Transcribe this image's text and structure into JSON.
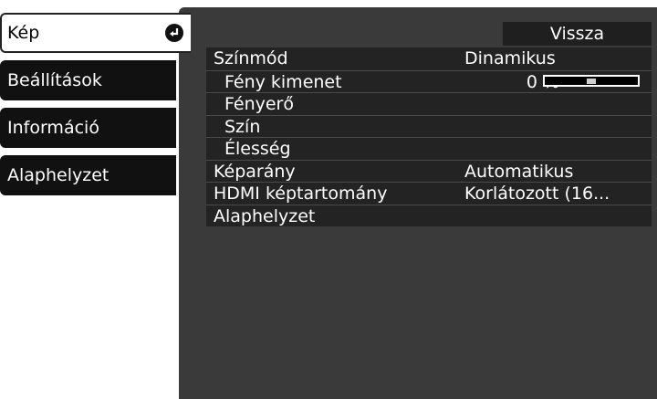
{
  "tabs": [
    {
      "label": "Kép",
      "active": true,
      "icon": "return-icon"
    },
    {
      "label": "Beállítások",
      "active": false
    },
    {
      "label": "Információ",
      "active": false
    },
    {
      "label": "Alaphelyzet",
      "active": false
    }
  ],
  "panel": {
    "back_label": "Vissza",
    "rows": [
      {
        "label": "Színmód",
        "value": "Dinamikus"
      },
      {
        "label": "Fény kimenet",
        "value": "0 %",
        "slider_fraction": 0.5
      },
      {
        "label": "Fényerő",
        "value": ""
      },
      {
        "label": "Szín",
        "value": ""
      },
      {
        "label": "Élesség",
        "value": ""
      },
      {
        "label": "Képarány",
        "value": "Automatikus"
      },
      {
        "label": "HDMI képtartomány",
        "value": "Korlátozott (16..."
      },
      {
        "label": "Alaphelyzet",
        "value": ""
      }
    ]
  },
  "colors": {
    "panel_bg": "#3a3a3a",
    "row_bg": "#232323",
    "tab_bg": "#111111",
    "text": "#ffffff"
  }
}
